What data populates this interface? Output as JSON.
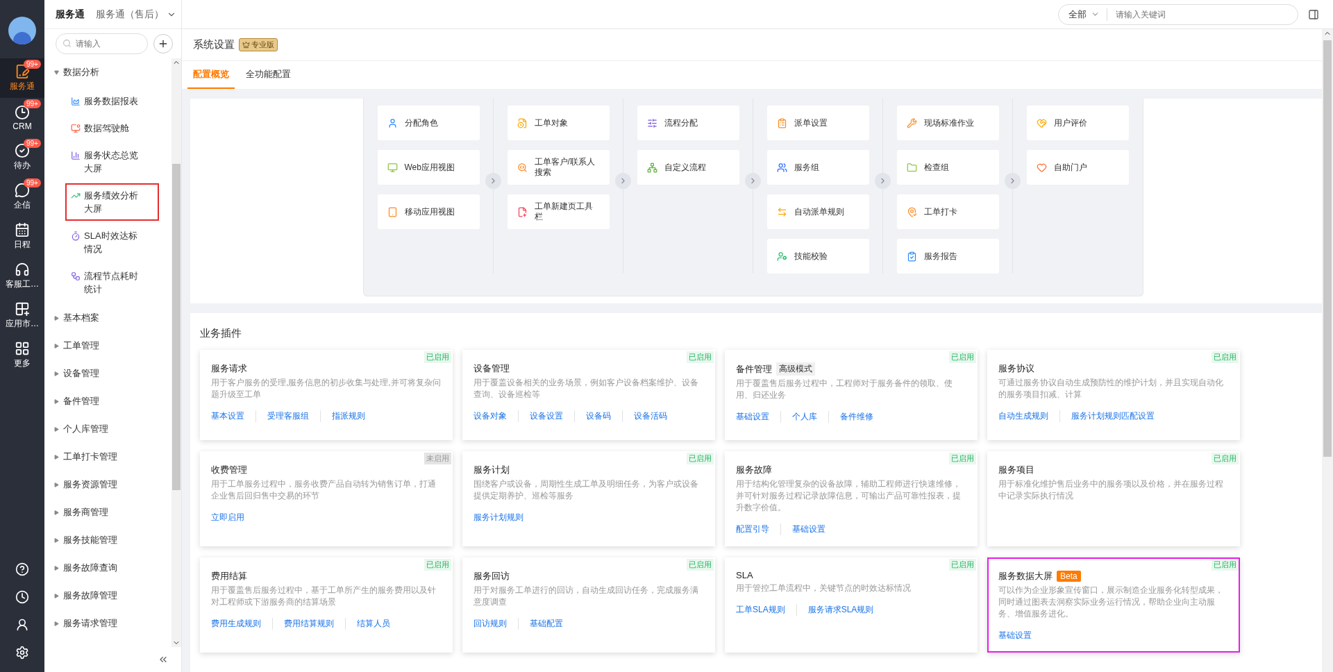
{
  "rail": {
    "items": [
      {
        "label": "服务通",
        "badge": "99+",
        "selected": true
      },
      {
        "label": "CRM",
        "badge": "99+",
        "selected": false
      },
      {
        "label": "待办",
        "badge": "99+",
        "selected": false
      },
      {
        "label": "企信",
        "badge": "99+",
        "selected": false
      },
      {
        "label": "日程",
        "selected": false
      },
      {
        "label": "客服工…",
        "selected": false
      },
      {
        "label": "应用市…",
        "selected": false
      },
      {
        "label": "更多",
        "selected": false
      }
    ]
  },
  "topbar": {
    "title": "服务通",
    "app_switch": "服务通（售后）",
    "search_scope": "全部",
    "search_placeholder": "请输入关键词"
  },
  "sidebar": {
    "search_placeholder": "请输入",
    "items": [
      {
        "label": "数据分析",
        "expanded": true,
        "children": [
          {
            "label": "服务数据报表",
            "highlighted": false
          },
          {
            "label": "数据驾驶舱",
            "highlighted": false
          },
          {
            "label": "服务状态总览大屏",
            "highlighted": false
          },
          {
            "label": "服务绩效分析大屏",
            "highlighted": true
          },
          {
            "label": "SLA时效达标情况",
            "highlighted": false
          },
          {
            "label": "流程节点耗时统计",
            "highlighted": false
          }
        ]
      },
      {
        "label": "基本档案",
        "expanded": false
      },
      {
        "label": "工单管理",
        "expanded": false
      },
      {
        "label": "设备管理",
        "expanded": false
      },
      {
        "label": "备件管理",
        "expanded": false
      },
      {
        "label": "个人库管理",
        "expanded": false
      },
      {
        "label": "工单打卡管理",
        "expanded": false
      },
      {
        "label": "服务资源管理",
        "expanded": false
      },
      {
        "label": "服务商管理",
        "expanded": false
      },
      {
        "label": "服务技能管理",
        "expanded": false
      },
      {
        "label": "服务故障查询",
        "expanded": false
      },
      {
        "label": "服务故障管理",
        "expanded": false
      },
      {
        "label": "服务请求管理",
        "expanded": false
      }
    ]
  },
  "page": {
    "title": "系统设置",
    "edition": "专业版",
    "tabs": [
      {
        "label": "配置概览",
        "selected": true
      },
      {
        "label": "全功能配置",
        "selected": false
      }
    ]
  },
  "config_overview": {
    "columns": [
      [
        "分配角色",
        "Web应用视图",
        "移动应用视图"
      ],
      [
        "工单对象",
        "工单客户/联系人搜索",
        "工单新建页工具栏"
      ],
      [
        "流程分配",
        "自定义流程"
      ],
      [
        "派单设置",
        "服务组",
        "自动派单规则",
        "技能校验"
      ],
      [
        "现场标准作业",
        "检查组",
        "工单打卡",
        "服务报告"
      ],
      [
        "用户评价",
        "自助门户"
      ]
    ]
  },
  "plugins": {
    "title": "业务插件",
    "cards": [
      {
        "title": "服务请求",
        "status": "已启用",
        "enabled": true,
        "highlighted": false,
        "description": "用于客户服务的受理,服务信息的初步收集与处理,并可将复杂问题升级至工单",
        "links": [
          "基本设置",
          "受理客服组",
          "指派规则"
        ]
      },
      {
        "title": "设备管理",
        "status": "已启用",
        "enabled": true,
        "highlighted": false,
        "description": "用于覆盖设备相关的业务场景，例如客户设备档案维护、设备查询、设备巡检等",
        "links": [
          "设备对象",
          "设备设置",
          "设备码",
          "设备活码"
        ]
      },
      {
        "title": "备件管理",
        "tag": {
          "kind": "mode",
          "text": "高级模式"
        },
        "status": "已启用",
        "enabled": true,
        "highlighted": false,
        "description": "用于覆盖售后服务过程中，工程师对于服务备件的领取、使用、归还业务",
        "links": [
          "基础设置",
          "个人库",
          "备件维修"
        ]
      },
      {
        "title": "服务协议",
        "status": "已启用",
        "enabled": true,
        "highlighted": false,
        "description": "可通过服务协议自动生成预防性的维护计划，并且实现自动化的服务项目扣减、计算",
        "links": [
          "自动生成规则",
          "服务计划规则匹配设置"
        ]
      },
      {
        "title": "收费管理",
        "status": "未启用",
        "enabled": false,
        "highlighted": false,
        "description": "用于工单服务过程中，服务收费产品自动转为销售订单，打通企业售后回归售中交易的环节",
        "links": [
          "立即启用"
        ]
      },
      {
        "title": "服务计划",
        "status": "已启用",
        "enabled": true,
        "highlighted": false,
        "description": "围绕客户或设备，周期性生成工单及明细任务，为客户或设备提供定期养护、巡检等服务",
        "links": [
          "服务计划规则"
        ]
      },
      {
        "title": "服务故障",
        "status": "已启用",
        "enabled": true,
        "highlighted": false,
        "description": "用于结构化管理复杂的设备故障，辅助工程师进行快速维修，并可针对服务过程记录故障信息，可输出产品可靠性报表，提升数字价值。",
        "links": [
          "配置引导",
          "基础设置"
        ]
      },
      {
        "title": "服务项目",
        "status": "已启用",
        "enabled": true,
        "highlighted": false,
        "description": "用于标准化维护售后业务中的服务项以及价格，并在服务过程中记录实际执行情况"
      },
      {
        "title": "费用结算",
        "status": "已启用",
        "enabled": true,
        "highlighted": false,
        "description": "用于覆盖售后服务过程中，基于工单所产生的服务费用以及针对工程师或下游服务商的结算场景",
        "links": [
          "费用生成规则",
          "费用结算规则",
          "结算人员"
        ]
      },
      {
        "title": "服务回访",
        "status": "已启用",
        "enabled": true,
        "highlighted": false,
        "description": "用于对服务工单进行的回访，自动生成回访任务，完成服务满意度调查",
        "links": [
          "回访规则",
          "基础配置"
        ]
      },
      {
        "title": "SLA",
        "status": "已启用",
        "enabled": true,
        "highlighted": false,
        "description": "用于管控工单流程中，关键节点的时效达标情况",
        "links": [
          "工单SLA规则",
          "服务请求SLA规则"
        ]
      },
      {
        "title": "服务数据大屏",
        "tag": {
          "kind": "beta",
          "text": "Beta"
        },
        "status": "已启用",
        "enabled": true,
        "highlighted": true,
        "description": "可以作为企业形象宣传窗口，展示制造企业服务化转型成果，同时通过图表去洞察实际业务运行情况，帮助企业向主动服务、增值服务进化。",
        "links": [
          "基础设置"
        ]
      }
    ]
  }
}
